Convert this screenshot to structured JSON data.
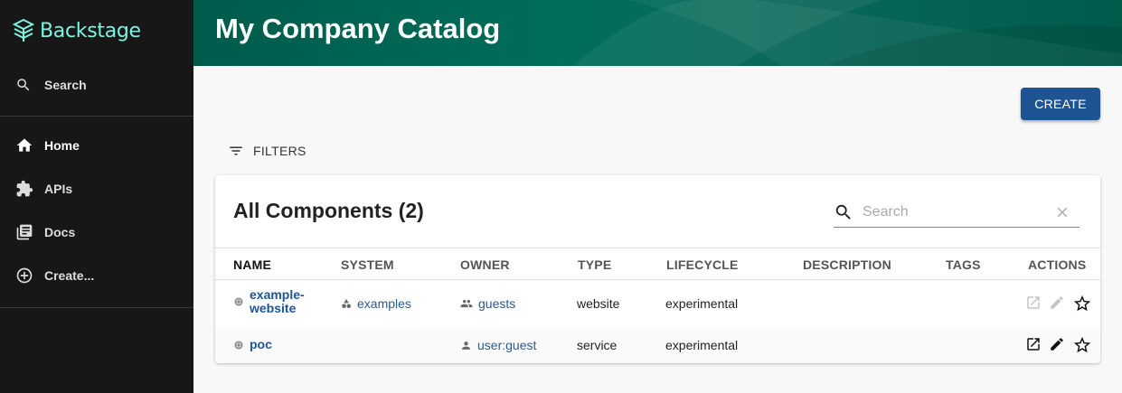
{
  "sidebar": {
    "logo_text": "Backstage",
    "search_label": "Search",
    "items": [
      {
        "label": "Home",
        "icon": "home-icon"
      },
      {
        "label": "APIs",
        "icon": "puzzle-icon"
      },
      {
        "label": "Docs",
        "icon": "library-icon"
      },
      {
        "label": "Create...",
        "icon": "add-circle-icon"
      }
    ],
    "active": "Home"
  },
  "header": {
    "title": "My Company Catalog"
  },
  "toolbar": {
    "create_label": "CREATE",
    "filters_label": "FILTERS"
  },
  "table": {
    "title": "All Components (2)",
    "search_placeholder": "Search",
    "columns": [
      "NAME",
      "SYSTEM",
      "OWNER",
      "TYPE",
      "LIFECYCLE",
      "DESCRIPTION",
      "TAGS",
      "ACTIONS"
    ],
    "rows": [
      {
        "name": "example-website",
        "name_line1": "example-",
        "name_line2": "website",
        "system": "examples",
        "owner": "guests",
        "type": "website",
        "lifecycle": "experimental",
        "description": "",
        "tags": "",
        "actions_enabled": false
      },
      {
        "name": "poc",
        "system": "",
        "owner": "user:guest",
        "type": "service",
        "lifecycle": "experimental",
        "description": "",
        "tags": "",
        "actions_enabled": true
      }
    ]
  },
  "colors": {
    "sidebar_bg": "#171717",
    "logo": "#7df3e1",
    "header": "#005b4b",
    "primary": "#1f5493"
  }
}
